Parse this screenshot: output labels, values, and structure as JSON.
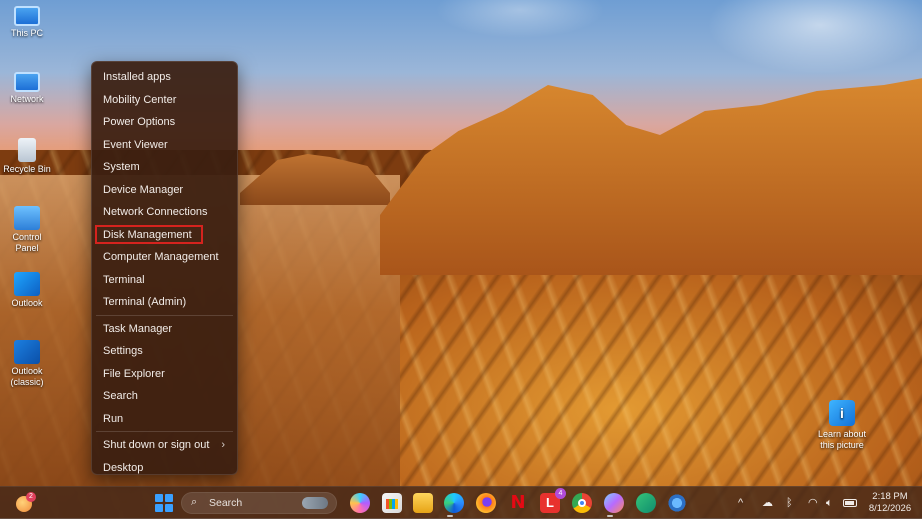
{
  "desktop": {
    "icons": [
      {
        "label": "This PC",
        "icon": "pc-icon"
      },
      {
        "label": "Network",
        "icon": "network-icon"
      },
      {
        "label": "Recycle Bin",
        "icon": "recycle-bin-icon"
      },
      {
        "label": "Control Panel",
        "icon": "control-panel-icon"
      },
      {
        "label": "Outlook",
        "icon": "outlook-icon"
      },
      {
        "label": "Outlook (classic)",
        "icon": "outlook-classic-icon"
      }
    ],
    "learn_label": "Learn about this picture"
  },
  "context_menu": {
    "items": [
      {
        "label": "Installed apps"
      },
      {
        "label": "Mobility Center"
      },
      {
        "label": "Power Options"
      },
      {
        "label": "Event Viewer"
      },
      {
        "label": "System"
      },
      {
        "label": "Device Manager"
      },
      {
        "label": "Network Connections"
      },
      {
        "label": "Disk Management",
        "highlighted": true
      },
      {
        "label": "Computer Management"
      },
      {
        "label": "Terminal"
      },
      {
        "label": "Terminal (Admin)"
      },
      {
        "label": "Task Manager"
      },
      {
        "label": "Settings"
      },
      {
        "label": "File Explorer"
      },
      {
        "label": "Search"
      },
      {
        "label": "Run"
      },
      {
        "label": "Shut down or sign out",
        "submenu": true
      },
      {
        "label": "Desktop"
      }
    ],
    "highlight_color": "#d5231e"
  },
  "taskbar": {
    "widget_badge": "2",
    "search_placeholder": "Search",
    "apps": [
      "copilot-icon",
      "store-icon",
      "file-explorer-icon",
      "edge-icon",
      "firefox-icon",
      "netflix-icon",
      "l-app-icon",
      "chrome-icon",
      "paint-icon",
      "clipchamp-icon",
      "settings-icon"
    ],
    "netflix_glyph": "N",
    "l_app_glyph": "L",
    "l_app_badge": "4",
    "tray": {
      "chevron": "^"
    },
    "clock": {
      "time": "2:18 PM",
      "date": "8/12/2026"
    }
  }
}
